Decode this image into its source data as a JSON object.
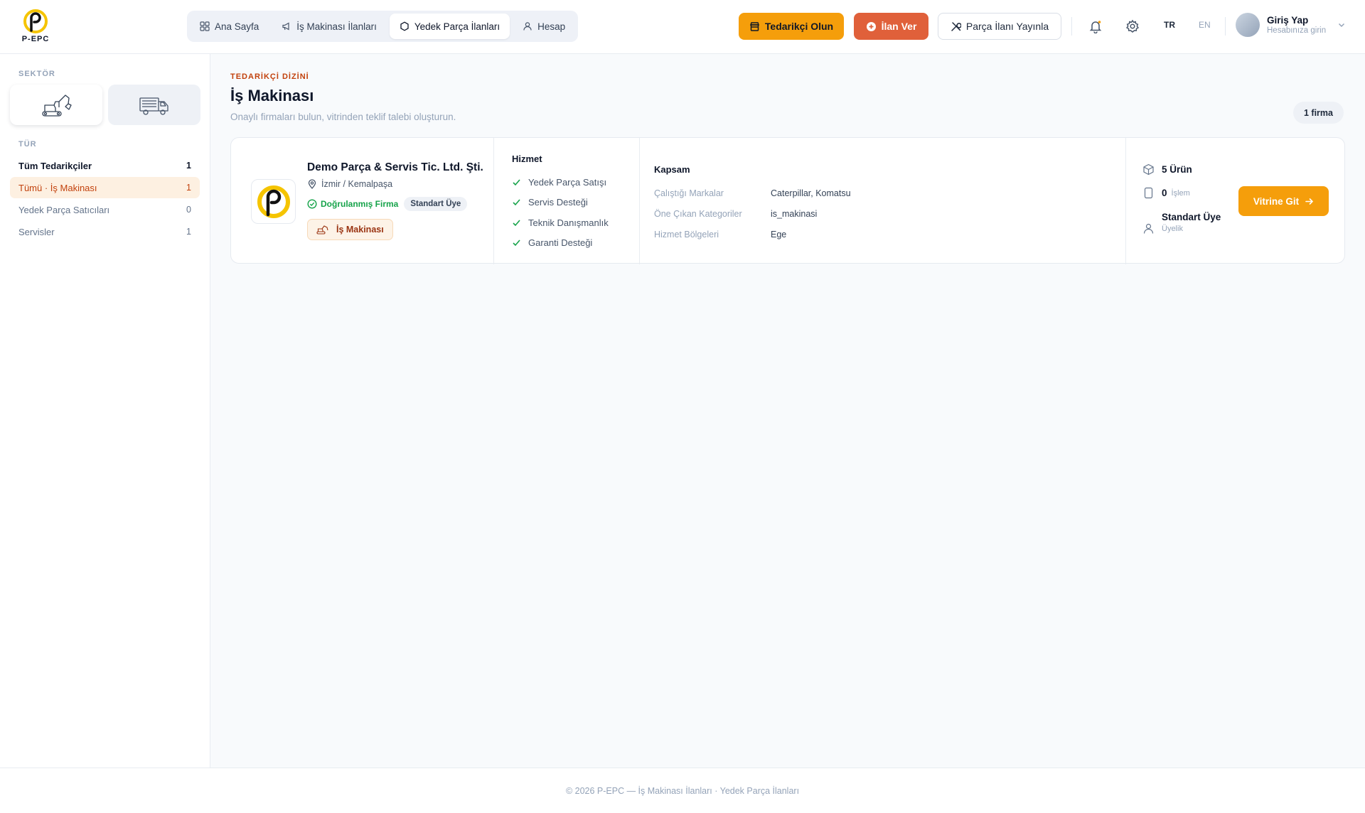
{
  "brand": {
    "name": "P-EPC"
  },
  "nav": {
    "items": [
      {
        "label": "Ana Sayfa",
        "icon": "grid-icon"
      },
      {
        "label": "İş Makinası İlanları",
        "icon": "megaphone-icon"
      },
      {
        "label": "Yedek Parça İlanları",
        "icon": "hexagon-icon",
        "active": true
      },
      {
        "label": "Hesap",
        "icon": "user-icon"
      }
    ]
  },
  "actions": {
    "supplier_label": "Tedarikçi Olun",
    "post_ad_label": "İlan Ver",
    "publish_part_label": "Parça İlanı Yayınla"
  },
  "lang": {
    "tr": "TR",
    "en": "EN"
  },
  "user": {
    "name": "Giriş Yap",
    "subtitle": "Hesabınıza girin"
  },
  "sidebar": {
    "sector_label": "SEKTÖR",
    "sectors": [
      {
        "icon": "excavator-icon",
        "active": true
      },
      {
        "icon": "truck-icon",
        "active": false
      }
    ],
    "type_label": "TÜR",
    "types": [
      {
        "label": "Tüm Tedarikçiler",
        "count": "1"
      },
      {
        "label": "Tümü · İş Makinası",
        "count": "1"
      },
      {
        "label": "Yedek Parça Satıcıları",
        "count": "0"
      },
      {
        "label": "Servisler",
        "count": "1"
      }
    ]
  },
  "main": {
    "eyebrow": "TEDARİKÇİ DİZİNİ",
    "title": "İş Makinası",
    "subtitle": "Onaylı firmaları bulun, vitrinden teklif talebi oluşturun.",
    "count_badge": "1 firma"
  },
  "supplier": {
    "name": "Demo Parça & Servis Tic. Ltd. Şti.",
    "location": "İzmir / Kemalpaşa",
    "verified_label": "Doğrulanmış Firma",
    "membership_chip": "Standart Üye",
    "sector_chip": "İş Makinası",
    "services_title": "Hizmet",
    "services": [
      "Yedek Parça Satışı",
      "Servis Desteği",
      "Teknik Danışmanlık",
      "Garanti Desteği"
    ],
    "scope_title": "Kapsam",
    "scope": [
      {
        "key": "Çalıştığı Markalar",
        "value": "Caterpillar, Komatsu"
      },
      {
        "key": "Öne Çıkan Kategoriler",
        "value": "is_makinasi"
      },
      {
        "key": "Hizmet Bölgeleri",
        "value": "Ege"
      }
    ],
    "stats": {
      "products": "5 Ürün",
      "transactions_count": "0",
      "transactions_label": "İşlem",
      "membership_value": "Standart Üye",
      "membership_label": "Üyelik"
    },
    "cta_label": "Vitrine Git"
  },
  "footer": {
    "text": "© 2026 P-EPC — İş Makinası İlanları · Yedek Parça İlanları"
  },
  "colors": {
    "accent": "#f59e0b",
    "danger": "#e0603a",
    "verified": "#16a34a",
    "active_bg": "#fdf0e1"
  }
}
